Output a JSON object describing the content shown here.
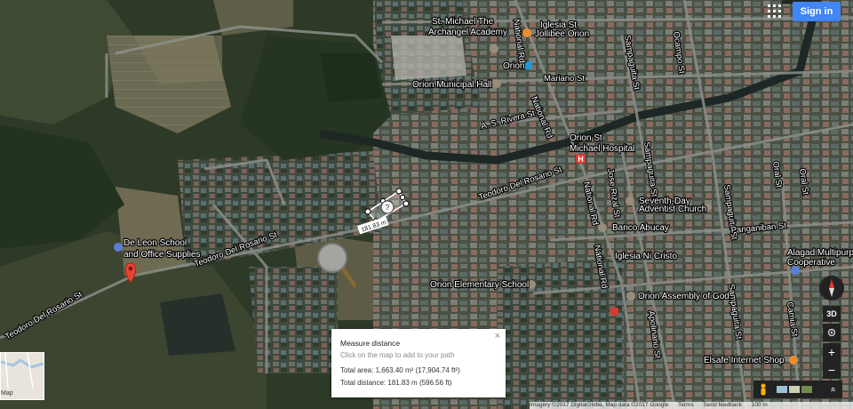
{
  "header": {
    "signin_label": "Sign in"
  },
  "places": {
    "st_michael": "St. Michael The\nArchangel Academy",
    "st_michael_line1": "St. Michael The",
    "st_michael_line2": "Archangel Academy",
    "jollibee": "Jollibee Orion",
    "orion_station": "Orion",
    "municipal_hall": "Orion Municipal Hall",
    "hospital_line1": "Orion St",
    "hospital_line2": "Michael Hospital",
    "seventh_day_line1": "Seventh-Day",
    "seventh_day_line2": "Adventist Church",
    "banco": "Banco Abucay",
    "iglesia": "Iglesia Ni Cristo",
    "de_leon_line1": "De Leon School",
    "de_leon_line2": "and Office Supplies",
    "orion_elem": "Orion Elementary School",
    "assembly": "Orion Assembly of God",
    "alagad_line1": "Alagad Multipurpo",
    "alagad_line2": "Cooperative",
    "elsafe": "Elsafe Internet Shop",
    "top_partial": "Iglesia St"
  },
  "roads": {
    "national_rd": "National Rd",
    "mariano": "Mariano St",
    "rivera": "A. S. Rivera St",
    "teodoro": "Teodoro Del Rosario St",
    "sampaguita": "Sampaguita St",
    "rizal": "Jose Rizal St",
    "panganiban": "Panganiban St",
    "ocampo": "Ocampo St",
    "oral": "Oral St",
    "camia": "Camia St",
    "apolinario": "Apolinario St"
  },
  "measure_label": "181.83 m",
  "measure_panel": {
    "title": "Measure distance",
    "hint": "Click on the map to add to your path",
    "area": "Total area: 1,663.40 m² (17,904.74 ft²)",
    "distance": "Total distance: 181.83 m (596.56 ft)",
    "close": "×"
  },
  "controls": {
    "view_3d": "3D",
    "zoom_in": "+",
    "zoom_out": "−",
    "expand": "»"
  },
  "minimap": {
    "label": "Map"
  },
  "attribution": {
    "imagery": "Imagery ©2017 DigitalGlobe, Map data ©2017 Google",
    "terms": "Terms",
    "feedback": "Send feedback",
    "scale": "100 m"
  },
  "colors": {
    "accent": "#4285f4",
    "marker": "#ea4335",
    "panel": "#ffffff"
  }
}
